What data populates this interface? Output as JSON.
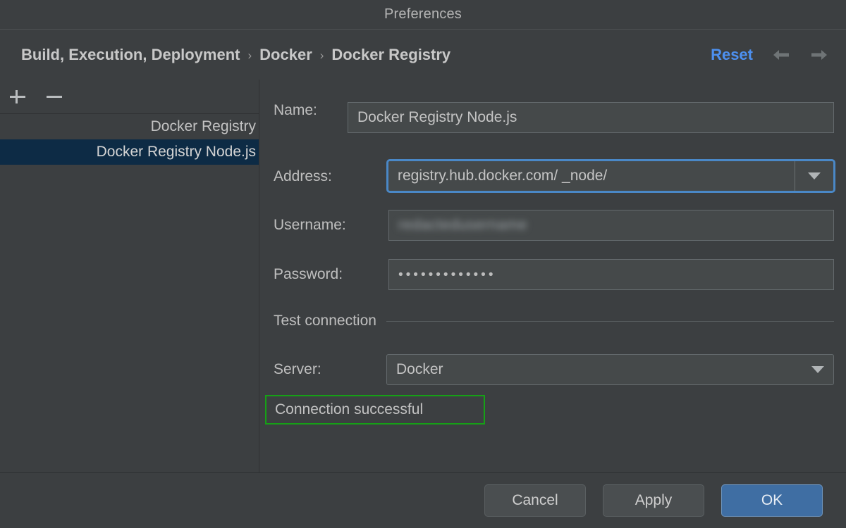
{
  "window": {
    "title": "Preferences"
  },
  "header": {
    "breadcrumb": [
      {
        "label": "Build, Execution, Deployment"
      },
      {
        "label": "Docker"
      },
      {
        "label": "Docker Registry"
      }
    ],
    "separator": "›",
    "reset_label": "Reset",
    "back_icon": "arrow-left-icon",
    "forward_icon": "arrow-right-icon",
    "reset_color": "#4d90f0"
  },
  "sidebar": {
    "toolbar": {
      "add_label": "+",
      "remove_label": "−"
    },
    "items": [
      {
        "label": "Docker Registry",
        "selected": false
      },
      {
        "label": "Docker Registry Node.js",
        "selected": true
      }
    ],
    "selected_bg": "#0d2b45"
  },
  "form": {
    "name": {
      "label": "Name:",
      "value": "Docker Registry Node.js"
    },
    "address": {
      "label": "Address:",
      "value": "registry.hub.docker.com/ _node/",
      "focused": true,
      "focus_color": "#4a88c7",
      "dropdown_icon": "chevron-down-icon"
    },
    "username": {
      "label": "Username:",
      "value": "redactedusername",
      "redacted": true
    },
    "password": {
      "label": "Password:",
      "value": "•••••••••••••"
    }
  },
  "test_connection": {
    "section_title": "Test connection",
    "server": {
      "label": "Server:",
      "value": "Docker",
      "dropdown_icon": "chevron-down-icon"
    },
    "status": {
      "text": "Connection successful",
      "highlight_color": "#16a016"
    }
  },
  "footer": {
    "cancel_label": "Cancel",
    "apply_label": "Apply",
    "ok_label": "OK",
    "ok_color": "#3f6ea3"
  }
}
